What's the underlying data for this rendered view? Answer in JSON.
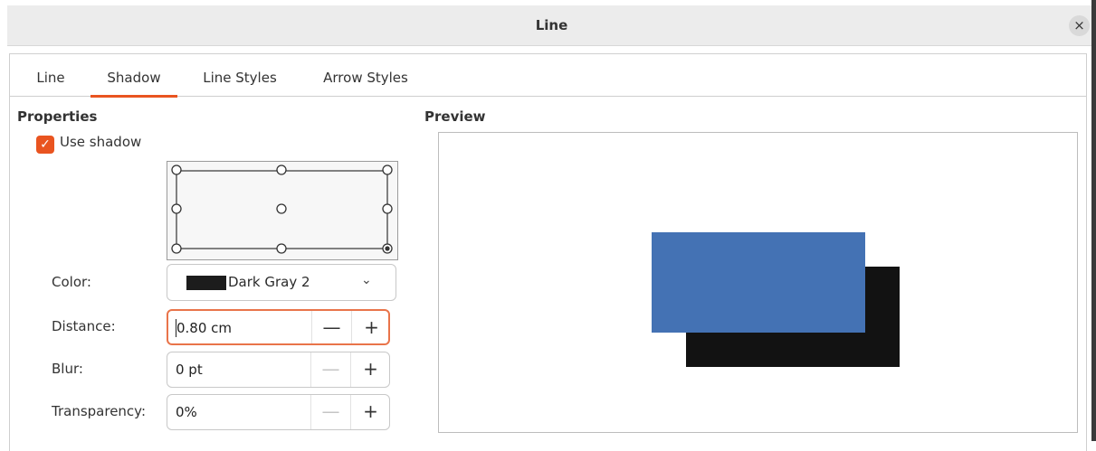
{
  "window": {
    "title": "Line",
    "close_glyph": "×"
  },
  "tabs": [
    {
      "label": "Line",
      "active": false
    },
    {
      "label": "Shadow",
      "active": true
    },
    {
      "label": "Line Styles",
      "active": false
    },
    {
      "label": "Arrow Styles",
      "active": false
    }
  ],
  "properties": {
    "title": "Properties",
    "use_shadow": {
      "label": "Use shadow",
      "checked": true
    },
    "position_grid": {
      "selected": "bottom-right"
    },
    "color": {
      "label": "Color:",
      "value": "Dark Gray 2",
      "swatch": "#1c1c1c"
    },
    "distance": {
      "label": "Distance:",
      "value": "0.80 cm"
    },
    "blur": {
      "label": "Blur:",
      "value": "0 pt"
    },
    "transparency": {
      "label": "Transparency:",
      "value": "0%"
    },
    "minus_glyph": "—",
    "plus_glyph": "+"
  },
  "preview": {
    "title": "Preview",
    "object_color": "#4472b4",
    "shadow_color": "#121212"
  },
  "colors": {
    "accent": "#e95420"
  }
}
